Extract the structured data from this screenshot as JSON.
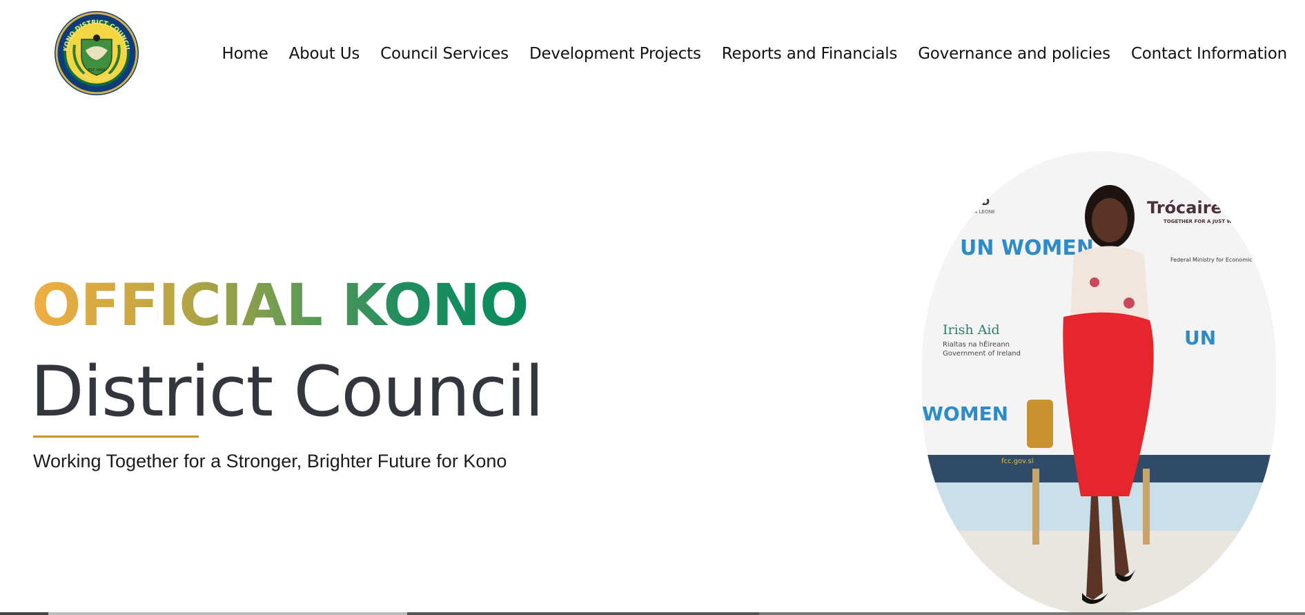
{
  "logo": {
    "ring_text": "KONO DISTRICT COUNCIL",
    "year_text": "EST. 2004",
    "motto": "Unwin in Diversity"
  },
  "nav": {
    "items": [
      "Home",
      "About Us",
      "Council Services",
      "Development Projects",
      "Reports and Financials",
      "Governance and policies",
      "Contact Information"
    ]
  },
  "hero": {
    "title_line1": "OFFICIAL KONO",
    "title_line2": "District Council",
    "tagline": "Working Together for a Stronger, Brighter Future for Kono"
  },
  "photo_backdrop": {
    "logos": [
      "UN WOMEN",
      "Trócaire",
      "TOGETHER FOR A JUST WORLD",
      "Irish Aid",
      "Rialtas na hÉireann",
      "Government of Ireland",
      "SEND",
      "SIERRA LEONE",
      "Federal Ministry for Economic Cooperation and Development",
      "fcc.gov.sl"
    ]
  },
  "colors": {
    "gradient_start": "#f0ae42",
    "gradient_end": "#088c5c",
    "heading": "#33363d",
    "accent_rule": "#c8952b"
  }
}
